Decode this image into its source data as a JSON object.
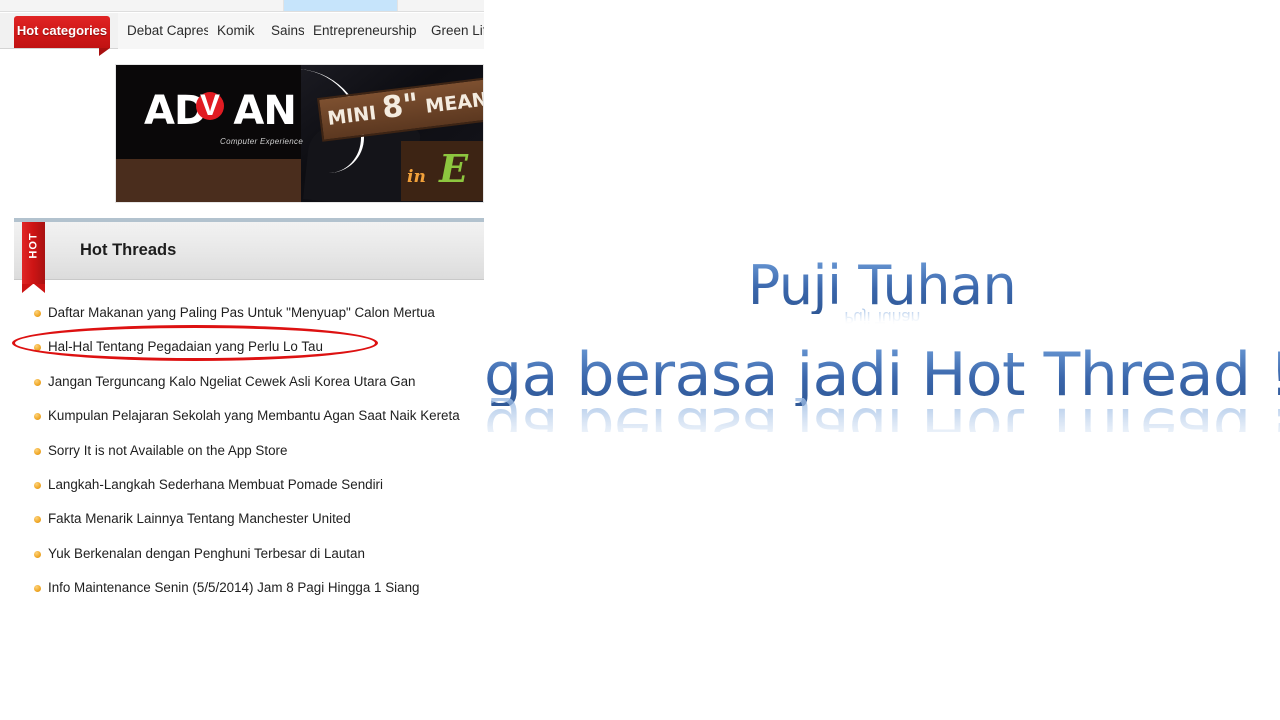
{
  "screenshot": {
    "tabs": [
      {
        "label": "Hot categories",
        "active": true
      },
      {
        "label": "Debat Capres",
        "active": false
      },
      {
        "label": "Komik",
        "active": false
      },
      {
        "label": "Sains",
        "active": false
      },
      {
        "label": "Entrepreneurship",
        "active": false
      },
      {
        "label": "Green Life",
        "active": false
      }
    ],
    "banner": {
      "brand": "AD",
      "brand_v": "V",
      "brand_end": "AN",
      "tagline": "Computer Experience",
      "headline_pre": "MINI ",
      "headline_num": "8\"",
      "headline_post": " MEANS",
      "headline_second_small": "in",
      "headline_second_big": "E"
    },
    "panel": {
      "ribbon_label": "HOT",
      "title": "Hot Threads"
    },
    "threads": [
      "Daftar Makanan yang Paling Pas Untuk \"Menyuap\" Calon Mertua",
      "Hal-Hal Tentang Pegadaian yang Perlu Lo Tau",
      "Jangan Terguncang Kalo Ngeliat Cewek Asli Korea Utara Gan",
      "Kumpulan Pelajaran Sekolah yang Membantu Agan Saat Naik Kereta",
      "Sorry It is not Available on the App Store",
      "Langkah-Langkah Sederhana Membuat Pomade Sendiri",
      "Fakta Menarik Lainnya Tentang Manchester United",
      "Yuk Berkenalan dengan Penghuni Terbesar di Lautan",
      "Info Maintenance Senin (5/5/2014) Jam 8 Pagi Hingga 1 Siang"
    ],
    "annotation": {
      "shape": "ellipse",
      "color": "#dd1111",
      "target_thread_index": 1
    }
  },
  "wordart": {
    "line1": "Puji Tuhan",
    "line2": "ga berasa jadi Hot Thread !",
    "color": "#3f6fb5"
  }
}
